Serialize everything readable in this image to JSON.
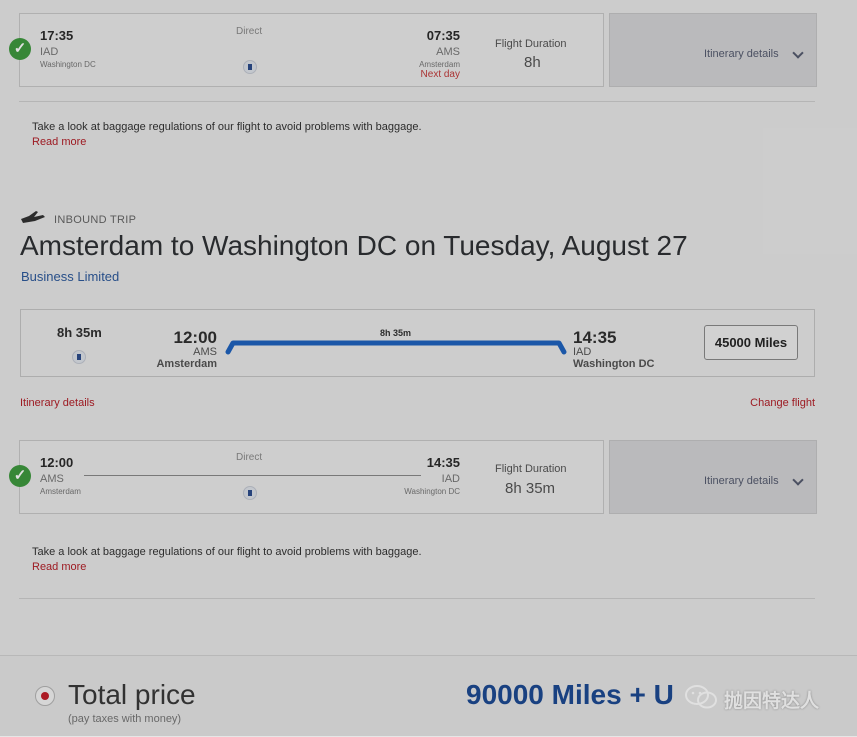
{
  "outbound_segment": {
    "depart_time": "17:35",
    "depart_code": "IAD",
    "depart_city": "Washington DC",
    "stop_label": "Direct",
    "arrive_time": "07:35",
    "arrive_code": "AMS",
    "arrive_city": "Amsterdam",
    "next_day": "Next day",
    "duration_label": "Flight Duration",
    "duration": "8h",
    "itinerary_label": "Itinerary details"
  },
  "outbound_note": {
    "text": "Take a look at baggage regulations of our flight to avoid problems with baggage.",
    "link": "Read more"
  },
  "inbound": {
    "trip_label": "INBOUND TRIP",
    "title": "Amsterdam to Washington DC on Tuesday, August 27",
    "cabin": "Business Limited",
    "summary": {
      "duration": "8h 35m",
      "depart_time": "12:00",
      "depart_code": "AMS",
      "depart_city": "Amsterdam",
      "bar_duration": "8h 35m",
      "arrive_time": "14:35",
      "arrive_code": "IAD",
      "arrive_city": "Washington DC",
      "miles_button": "45000 Miles"
    },
    "itinerary_link": "Itinerary details",
    "change_flight": "Change flight",
    "segment": {
      "depart_time": "12:00",
      "depart_code": "AMS",
      "depart_city": "Amsterdam",
      "stop_label": "Direct",
      "arrive_time": "14:35",
      "arrive_code": "IAD",
      "arrive_city": "Washington DC",
      "duration_label": "Flight Duration",
      "duration": "8h 35m",
      "itinerary_label": "Itinerary details"
    },
    "note": {
      "text": "Take a look at baggage regulations of our flight to avoid problems with baggage.",
      "link": "Read more"
    }
  },
  "footer": {
    "total_label": "Total price",
    "total_sub": "(pay taxes with money)",
    "price": "90000 Miles + U",
    "watermark": "抛因特达人"
  },
  "colors": {
    "accent_blue": "#1d4a93",
    "link_red": "#b31e27",
    "check_green": "#3f9a3f",
    "route_bar": "#1f64c0"
  }
}
